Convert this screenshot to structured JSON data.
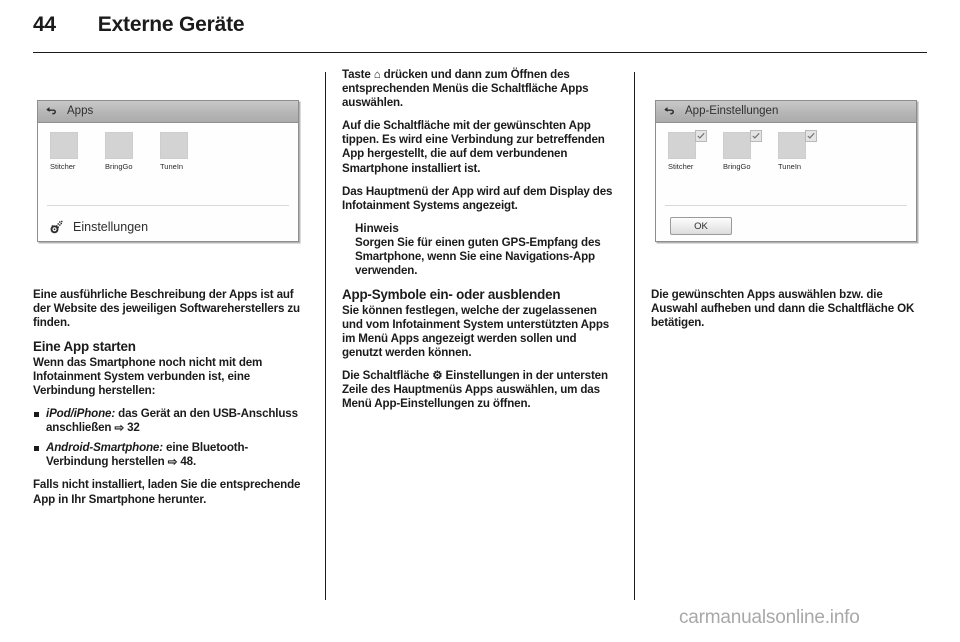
{
  "header": {
    "page_number": "44",
    "title": "Externe Geräte"
  },
  "figures": {
    "apps_screen": {
      "back_icon": "back-arrow-icon",
      "title": "Apps",
      "apps": [
        {
          "label": "Stitcher"
        },
        {
          "label": "BringGo"
        },
        {
          "label": "TuneIn"
        }
      ],
      "settings_icon": "gear-icon",
      "settings_label": "Einstellungen"
    },
    "app_settings_screen": {
      "back_icon": "back-arrow-icon",
      "title": "App-Einstellungen",
      "apps": [
        {
          "label": "Stitcher",
          "checked": true
        },
        {
          "label": "BringGo",
          "checked": true
        },
        {
          "label": "TuneIn",
          "checked": true
        }
      ],
      "ok_label": "OK"
    }
  },
  "left_column": {
    "intro_paragraph": "Eine ausführliche Beschreibung der Apps ist auf der Website des jeweiligen Softwareherstellers zu finden.",
    "heading_start_app": "Eine App starten",
    "paragraph_connect": "Wenn das Smartphone noch nicht mit dem Infotainment System verbunden ist, eine Verbindung herstellen:",
    "bullets": [
      {
        "bold_lead": "iPod/iPhone:",
        "text": " das Gerät an den USB-Anschluss anschließen ",
        "arrow": "⇨",
        "page_ref": "32"
      },
      {
        "bold_lead": "Android-Smartphone:",
        "text": " eine Bluetooth-Verbindung herstellen ",
        "arrow": "⇨",
        "page_ref": "48."
      }
    ],
    "paragraph_download": "Falls nicht installiert, laden Sie die entsprechende App in Ihr Smartphone herunter."
  },
  "middle_column": {
    "paragraph_press_key_pre": "Taste ",
    "home_symbol": "⌂",
    "paragraph_press_key_post": " drücken und dann zum Öffnen des entsprechenden Menüs die Schaltfläche Apps auswählen.",
    "paragraph_tap_app": "Auf die Schaltfläche mit der gewünschten App tippen. Es wird eine Verbindung zur betreffenden App hergestellt, die auf dem verbundenen Smartphone installiert ist.",
    "paragraph_main_menu": "Das Hauptmenü der App wird auf dem Display des Infotainment Systems angezeigt.",
    "note_title": "Hinweis",
    "note_text": "Sorgen Sie für einen guten GPS-Empfang des Smartphone, wenn Sie eine Navigations-App verwenden.",
    "heading_app_symbols": "App-Symbole ein- oder ausblenden",
    "paragraph_select_apps": "Sie können festlegen, welche der zugelassenen und vom Infotainment System unterstützten Apps im Menü Apps angezeigt werden sollen und genutzt werden können.",
    "paragraph_settings_button_pre": "Die Schaltfläche ",
    "settings_symbol": "⚙",
    "paragraph_settings_button_post": " Einstellungen in der untersten Zeile des Hauptmenüs Apps auswählen, um das Menü App-Einstellungen zu öffnen."
  },
  "right_column": {
    "paragraph_confirm": "Die gewünschten Apps auswählen bzw. die Auswahl aufheben und dann die Schaltfläche OK betätigen."
  },
  "watermark": {
    "text": "carmanualsonline.info"
  }
}
